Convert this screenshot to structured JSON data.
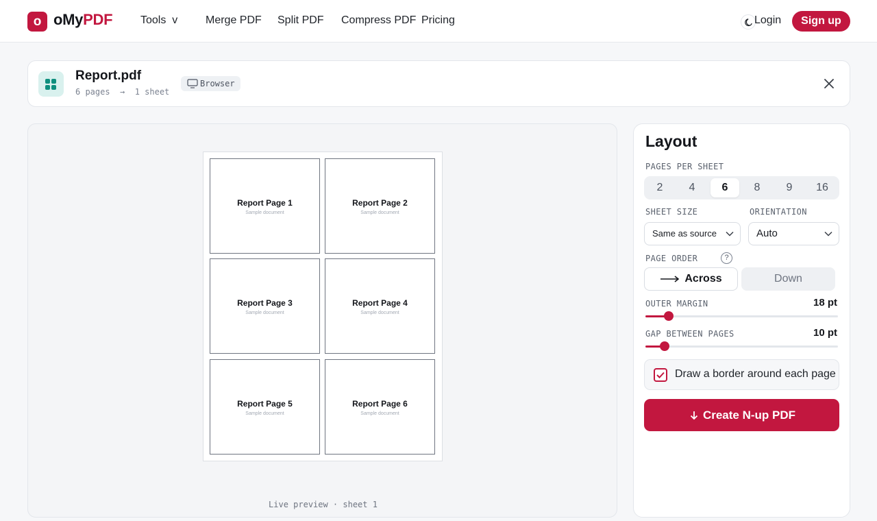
{
  "header": {
    "logo_letter": "o",
    "brand_dark": "oMy",
    "brand_accent": "PDF",
    "nav": {
      "tools": "Tools  v",
      "merge": "Merge PDF",
      "split": "Split PDF",
      "compress": "Compress PDF",
      "pricing": "Pricing"
    },
    "login": "Login",
    "signup": "Sign up"
  },
  "file": {
    "name": "Report.pdf",
    "meta": "6 pages  →  1 sheet",
    "badge": "Browser"
  },
  "preview": {
    "pages": [
      {
        "title": "Report Page 1",
        "subtitle": "Sample document"
      },
      {
        "title": "Report Page 2",
        "subtitle": "Sample document"
      },
      {
        "title": "Report Page 3",
        "subtitle": "Sample document"
      },
      {
        "title": "Report Page 4",
        "subtitle": "Sample document"
      },
      {
        "title": "Report Page 5",
        "subtitle": "Sample document"
      },
      {
        "title": "Report Page 6",
        "subtitle": "Sample document"
      }
    ],
    "caption": "Live preview · sheet 1"
  },
  "layout": {
    "title": "Layout",
    "pages_per_sheet_label": "PAGES PER SHEET",
    "pages_per_sheet_options": [
      "2",
      "4",
      "6",
      "8",
      "9",
      "16"
    ],
    "pages_per_sheet_selected": "6",
    "sheet_size_label": "SHEET SIZE",
    "sheet_size_value": "Same as source",
    "orientation_label": "ORIENTATION",
    "orientation_value": "Auto",
    "page_order_label": "PAGE ORDER",
    "page_order_help": "?",
    "page_order_across": "Across",
    "page_order_down": "Down",
    "page_order_selected": "Across",
    "outer_margin_label": "OUTER MARGIN",
    "outer_margin_value": "18 pt",
    "outer_margin_fraction": 0.12,
    "gap_label": "GAP BETWEEN PAGES",
    "gap_value": "10 pt",
    "gap_fraction": 0.1,
    "border_checkbox_label": "Draw a border around each page",
    "border_checked": true,
    "create_button": "Create N-up PDF"
  },
  "colors": {
    "accent": "#c2173f",
    "teal": "#0e8f7e"
  }
}
